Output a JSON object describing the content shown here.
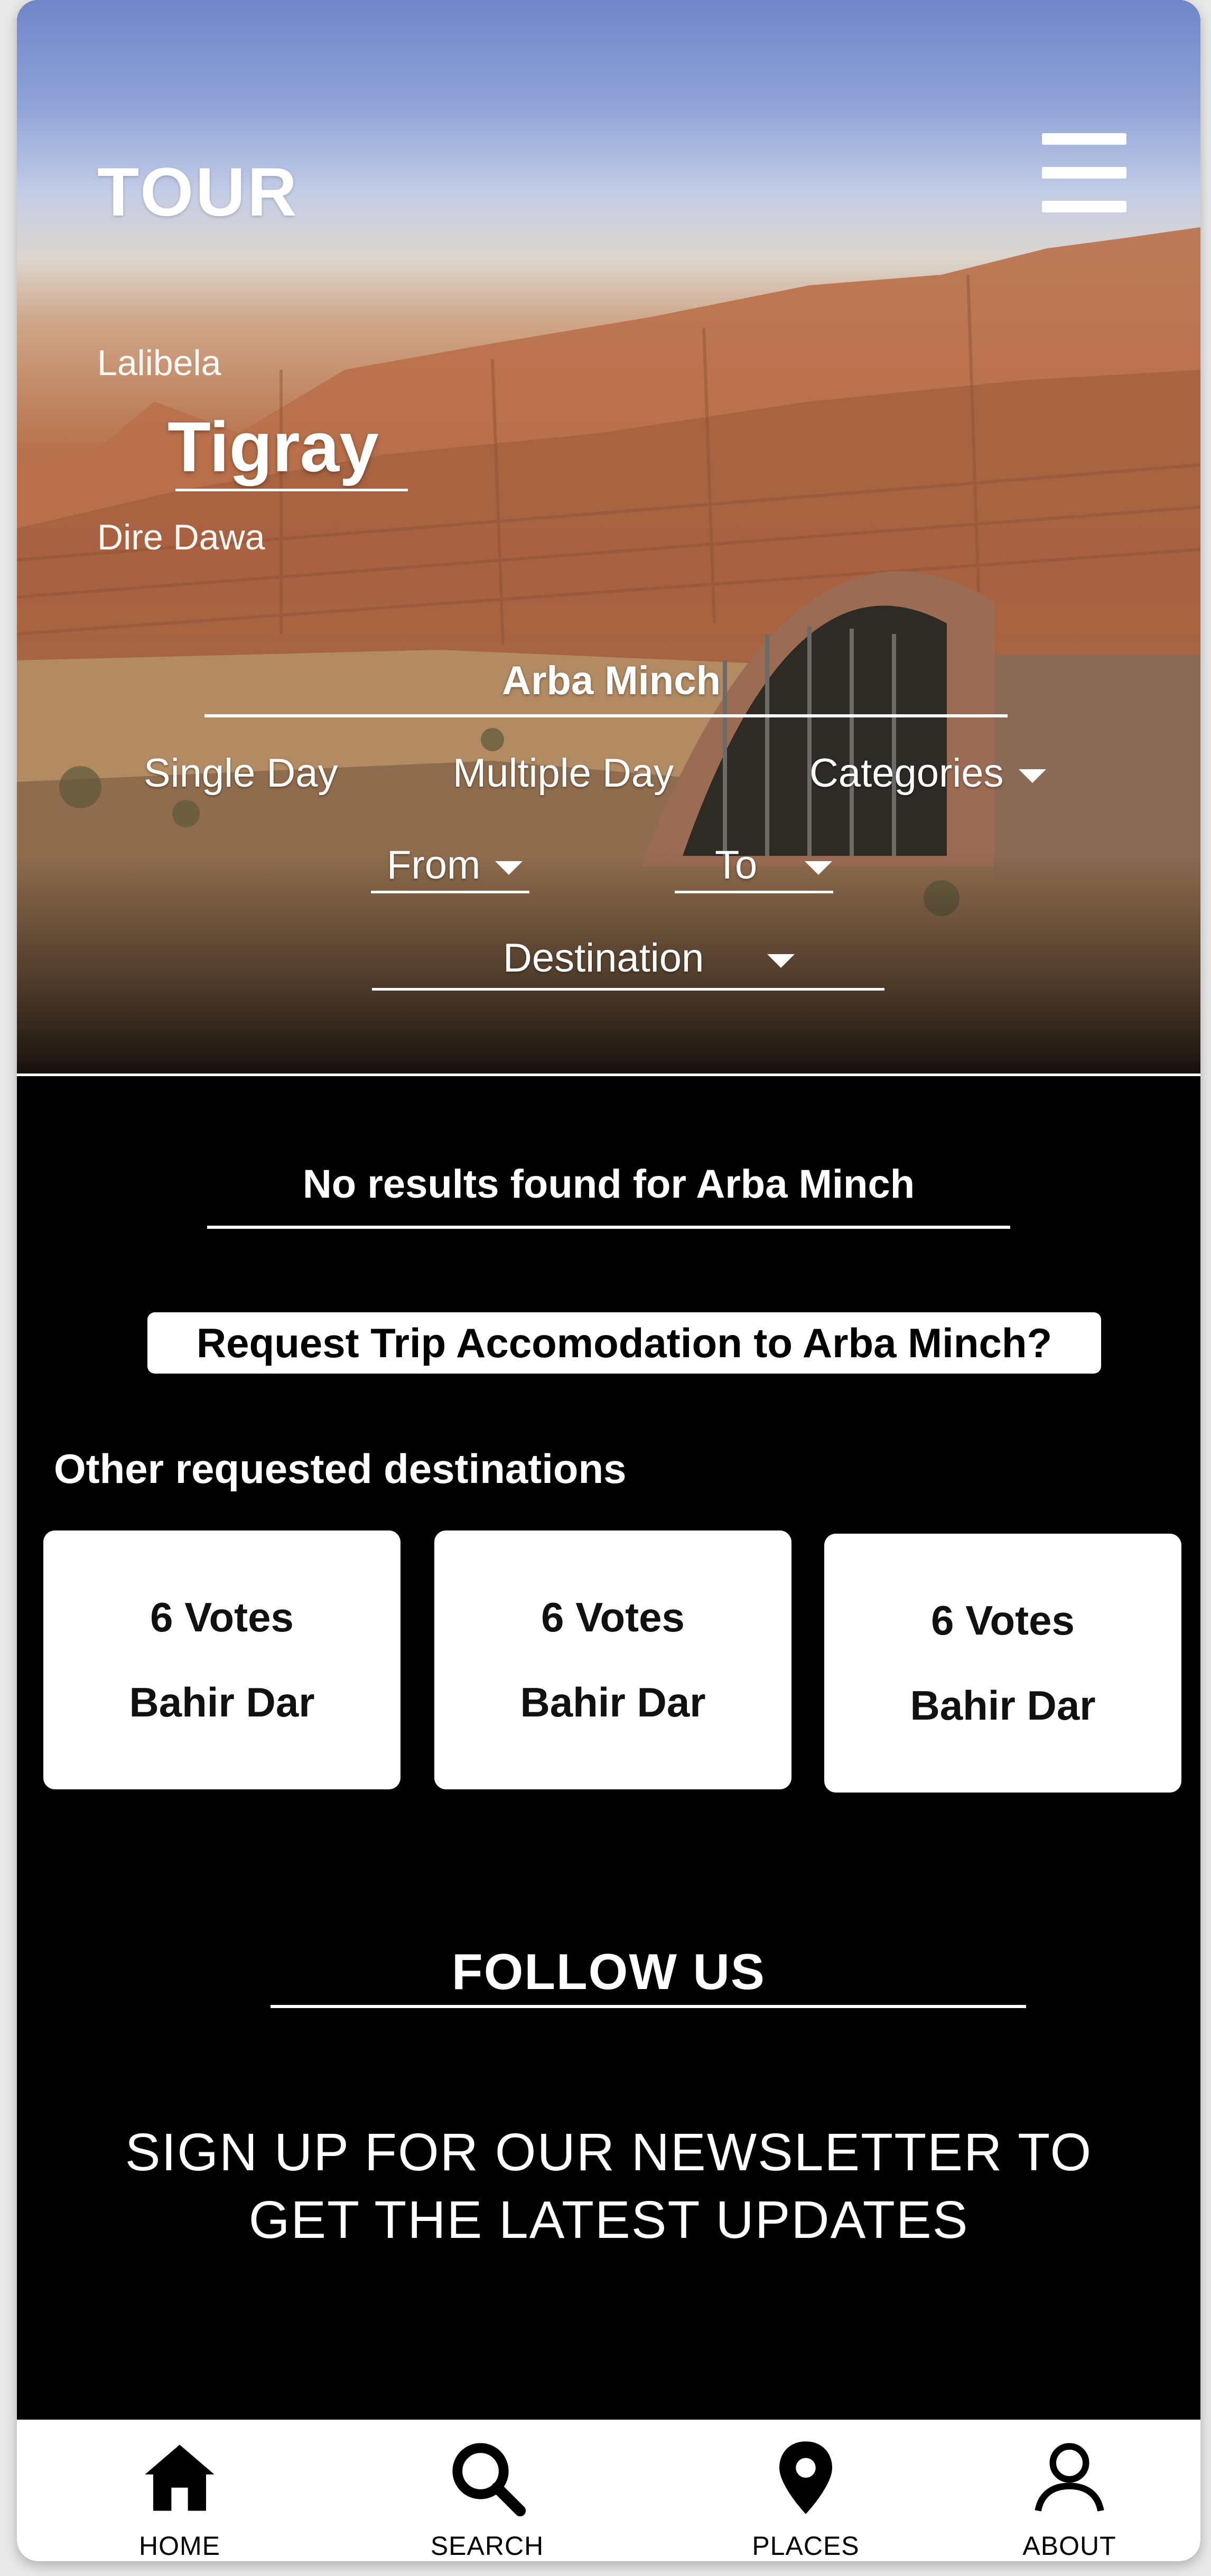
{
  "header": {
    "brand": "TOUR",
    "menu_icon": "hamburger-menu-icon"
  },
  "hero_carousel": {
    "previous": "Lalibela",
    "active": "Tigray",
    "next": "Dire Dawa"
  },
  "search": {
    "value": "Arba Minch"
  },
  "tabs": {
    "single_day": "Single Day",
    "multiple_day": "Multiple Day",
    "categories": "Categories"
  },
  "filters": {
    "from": "From",
    "to": "To",
    "destination": "Destination"
  },
  "results": {
    "message": "No results found for Arba Minch",
    "request_button": "Request Trip Accomodation to Arba Minch?"
  },
  "other_destinations": {
    "title": "Other requested destinations",
    "items": [
      {
        "votes": "6 Votes",
        "place": "Bahir Dar"
      },
      {
        "votes": "6 Votes",
        "place": "Bahir Dar"
      },
      {
        "votes": "6 Votes",
        "place": "Bahir Dar"
      }
    ]
  },
  "follow": {
    "title": "FOLLOW US"
  },
  "newsletter": {
    "line1": "SIGN UP FOR OUR NEWSLETTER TO",
    "line2": "GET THE LATEST UPDATES"
  },
  "bottom_nav": [
    {
      "label": "HOME",
      "icon": "home-icon"
    },
    {
      "label": "SEARCH",
      "icon": "search-icon"
    },
    {
      "label": "PLACES",
      "icon": "location-pin-icon"
    },
    {
      "label": "ABOUT",
      "icon": "user-icon"
    }
  ],
  "colors": {
    "background": "#000000",
    "text": "#ffffff",
    "card": "#ffffff"
  }
}
